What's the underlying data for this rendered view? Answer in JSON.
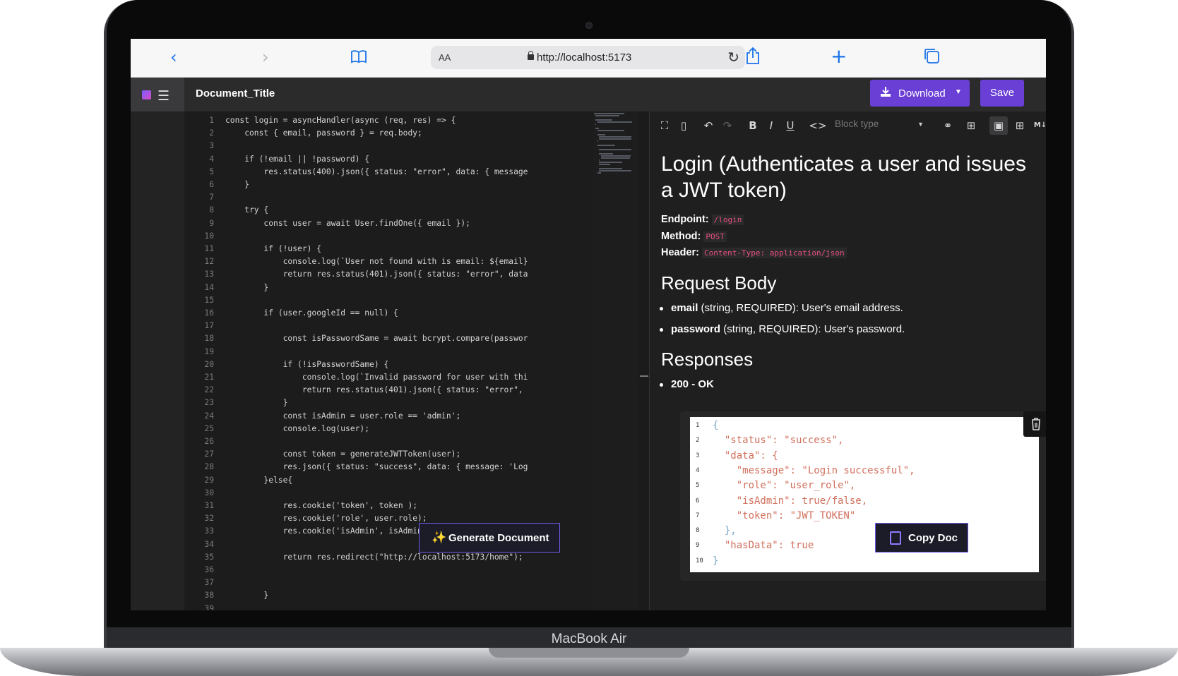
{
  "device": {
    "brand_label": "MacBook Air"
  },
  "browser": {
    "aa_label": "AA",
    "url": "http://localhost:5173",
    "icons": [
      "back-icon",
      "forward-icon",
      "bookmarks-icon",
      "lock-icon",
      "reload-icon",
      "share-icon",
      "new-tab-icon",
      "tabs-icon"
    ]
  },
  "app": {
    "document_title": "Document_Title",
    "download_label": "Download",
    "save_label": "Save",
    "accent_color": "#6a3fd6"
  },
  "code_lines": [
    "const login = asyncHandler(async (req, res) => {",
    "    const { email, password } = req.body;",
    "",
    "    if (!email || !password) {",
    "        res.status(400).json({ status: \"error\", data: { message",
    "    }",
    "",
    "    try {",
    "        const user = await User.findOne({ email });",
    "",
    "        if (!user) {",
    "            console.log(`User not found with is email: ${email}",
    "            return res.status(401).json({ status: \"error\", data",
    "        }",
    "",
    "        if (user.googleId == null) {",
    "",
    "            const isPasswordSame = await bcrypt.compare(passwor",
    "",
    "            if (!isPasswordSame) {",
    "                console.log(`Invalid password for user with thi",
    "                return res.status(401).json({ status: \"error\",",
    "            }",
    "            const isAdmin = user.role == 'admin';",
    "            console.log(user);",
    "",
    "            const token = generateJWTToken(user);",
    "            res.json({ status: \"success\", data: { message: 'Log",
    "        }else{",
    "",
    "            res.cookie('token', token );",
    "            res.cookie('role', user.role);",
    "            res.cookie('isAdmin', isAdmin);",
    "",
    "            return res.redirect(\"http://localhost:5173/home\");",
    "",
    "",
    "        }",
    ""
  ],
  "toolbar": {
    "block_type_placeholder": "Block type",
    "icons": [
      "fullscreen-icon",
      "split-view-icon",
      "undo-icon",
      "redo-icon",
      "bold-icon",
      "italic-icon",
      "underline-icon",
      "code-icon",
      "link-icon",
      "table-icon",
      "image-icon",
      "insert-icon",
      "markdown-icon"
    ]
  },
  "doc": {
    "title": "Login (Authenticates a user and issues a JWT token)",
    "endpoint_label": "Endpoint:",
    "endpoint_value": "/login",
    "method_label": "Method:",
    "method_value": "POST",
    "header_label": "Header:",
    "header_value": "Content-Type: application/json",
    "request_body_heading": "Request Body",
    "request_items": [
      {
        "name": "email",
        "desc": " (string, REQUIRED): User's email address."
      },
      {
        "name": "password",
        "desc": " (string, REQUIRED): User's password."
      }
    ],
    "responses_heading": "Responses",
    "response_item": "200 - OK",
    "json_lines": [
      "{",
      "  \"status\": \"success\",",
      "  \"data\": {",
      "    \"message\": \"Login successful\",",
      "    \"role\": \"user_role\",",
      "    \"isAdmin\": true/false,",
      "    \"token\": \"JWT_TOKEN\"",
      "  },",
      "  \"hasData\": true",
      "}"
    ]
  },
  "actions": {
    "generate_label": "Generate Document",
    "copy_label": "Copy Doc"
  }
}
